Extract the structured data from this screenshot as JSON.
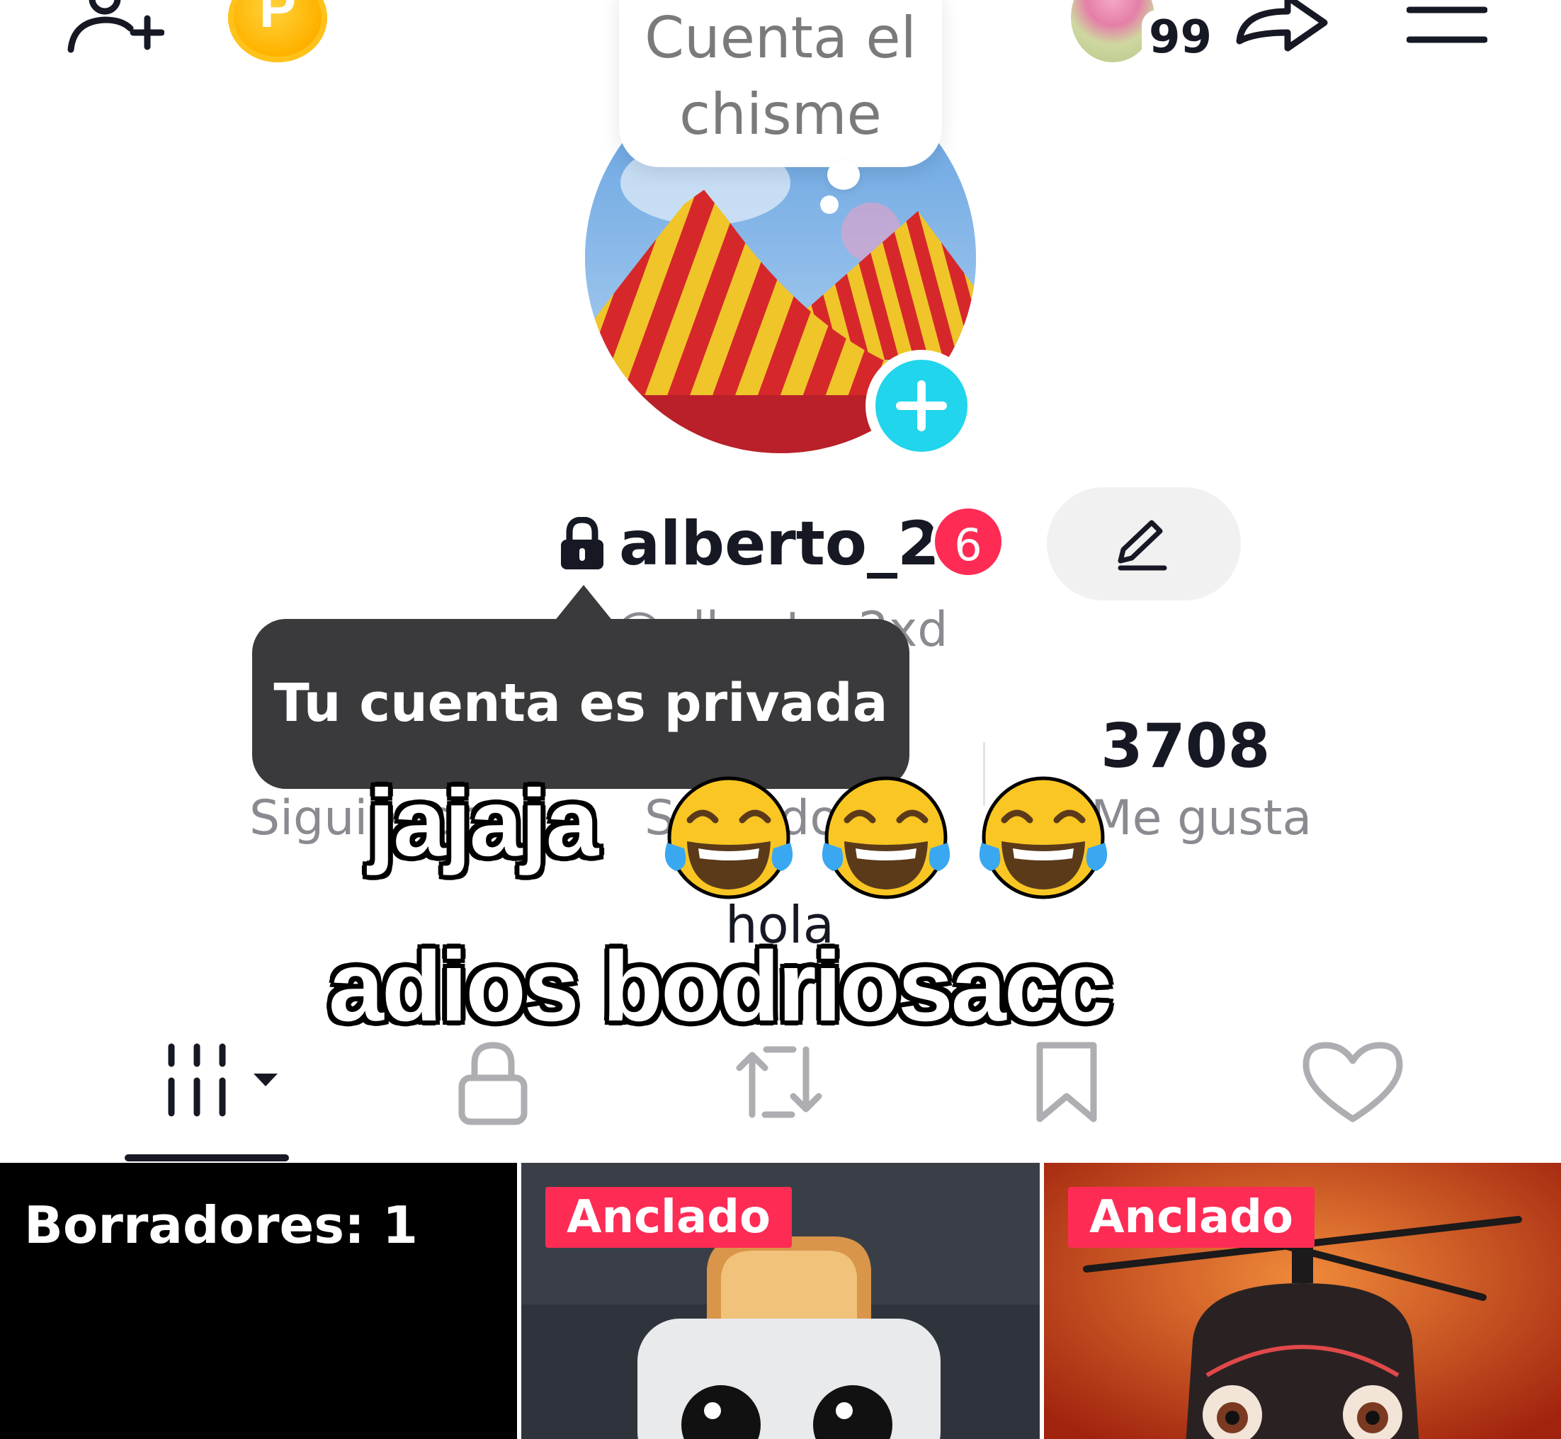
{
  "top_bar": {
    "add_friend_icon": "person-plus-icon",
    "coin_letter": "P",
    "friends_count": "99",
    "share_icon": "share-arrow-icon",
    "menu_icon": "hamburger-menu-icon"
  },
  "note": {
    "text": "Cuenta el chisme"
  },
  "profile": {
    "username": "alberto_2",
    "notification_count": "6",
    "handle": "@alberto_2xd",
    "edit_icon": "pencil-icon",
    "lock_icon": "lock-icon",
    "add_icon": "plus-icon"
  },
  "tooltip": {
    "text": "Tu cuenta es privada"
  },
  "stats": {
    "following_label": "Siguiendo",
    "followers_label": "Seguidores",
    "likes_value": "3708",
    "likes_label": "Me gusta"
  },
  "overlay": {
    "line1": "jajaja",
    "line1_emoji": "face-with-tears-of-joy",
    "hola": "hola",
    "line2": "adios bodriosacc"
  },
  "tabs": [
    {
      "icon": "grid-icon"
    },
    {
      "icon": "lock-icon"
    },
    {
      "icon": "repost-icon"
    },
    {
      "icon": "bookmark-icon"
    },
    {
      "icon": "heart-icon"
    }
  ],
  "grid": {
    "drafts_label": "Borradores: 1",
    "pinned_label_1": "Anclado",
    "pinned_label_2": "Anclado"
  },
  "colors": {
    "accent": "#fe2c55",
    "teal": "#20d5ec",
    "tooltip_bg": "#3a3a3c",
    "text": "#161823",
    "muted": "#8a8b91"
  }
}
